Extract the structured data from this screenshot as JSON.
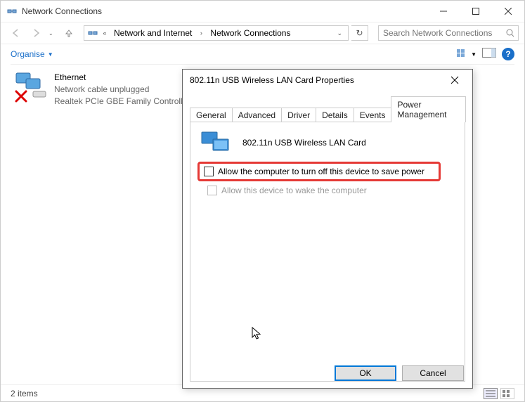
{
  "window": {
    "title": "Network Connections"
  },
  "address": {
    "seg0_prechev": "«",
    "seg1": "Network and Internet",
    "seg2": "Network Connections"
  },
  "search": {
    "placeholder": "Search Network Connections"
  },
  "toolbar": {
    "organise": "Organise"
  },
  "item": {
    "name": "Ethernet",
    "status": "Network cable unplugged",
    "adapter": "Realtek PCIe GBE Family Controller"
  },
  "dialog": {
    "title": "802.11n USB Wireless LAN Card Properties",
    "tabs": {
      "general": "General",
      "advanced": "Advanced",
      "driver": "Driver",
      "details": "Details",
      "events": "Events",
      "power": "Power Management"
    },
    "device_label": "802.11n USB Wireless LAN Card",
    "opt1": "Allow the computer to turn off this device to save power",
    "opt2": "Allow this device to wake the computer",
    "ok": "OK",
    "cancel": "Cancel"
  },
  "status": {
    "count": "2 items"
  }
}
